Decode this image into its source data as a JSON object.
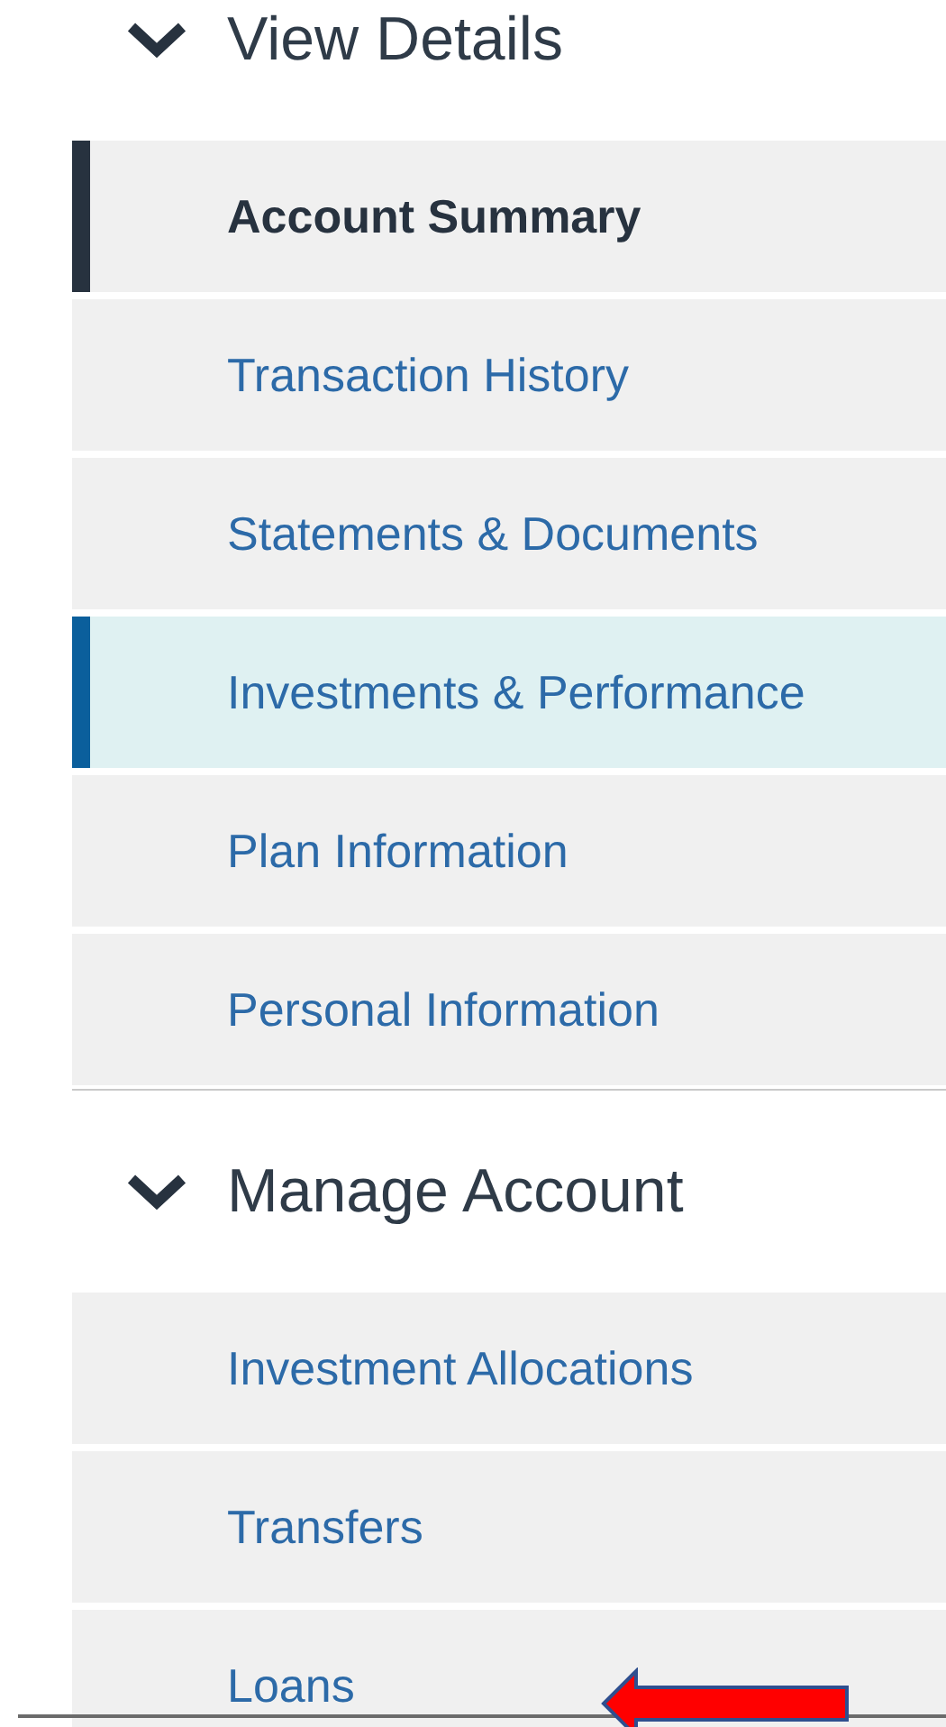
{
  "sections": [
    {
      "title": "View Details",
      "expanded": true,
      "items": [
        {
          "label": "Account Summary",
          "selected": true,
          "hovered": false
        },
        {
          "label": "Transaction History",
          "selected": false,
          "hovered": false
        },
        {
          "label": "Statements & Documents",
          "selected": false,
          "hovered": false
        },
        {
          "label": "Investments & Performance",
          "selected": false,
          "hovered": true
        },
        {
          "label": "Plan Information",
          "selected": false,
          "hovered": false
        },
        {
          "label": "Personal Information",
          "selected": false,
          "hovered": false
        }
      ]
    },
    {
      "title": "Manage Account",
      "expanded": true,
      "items": [
        {
          "label": "Investment Allocations",
          "selected": false,
          "hovered": false
        },
        {
          "label": "Transfers",
          "selected": false,
          "hovered": false
        },
        {
          "label": "Loans",
          "selected": false,
          "hovered": false
        }
      ]
    }
  ],
  "annotation": {
    "kind": "arrow"
  }
}
